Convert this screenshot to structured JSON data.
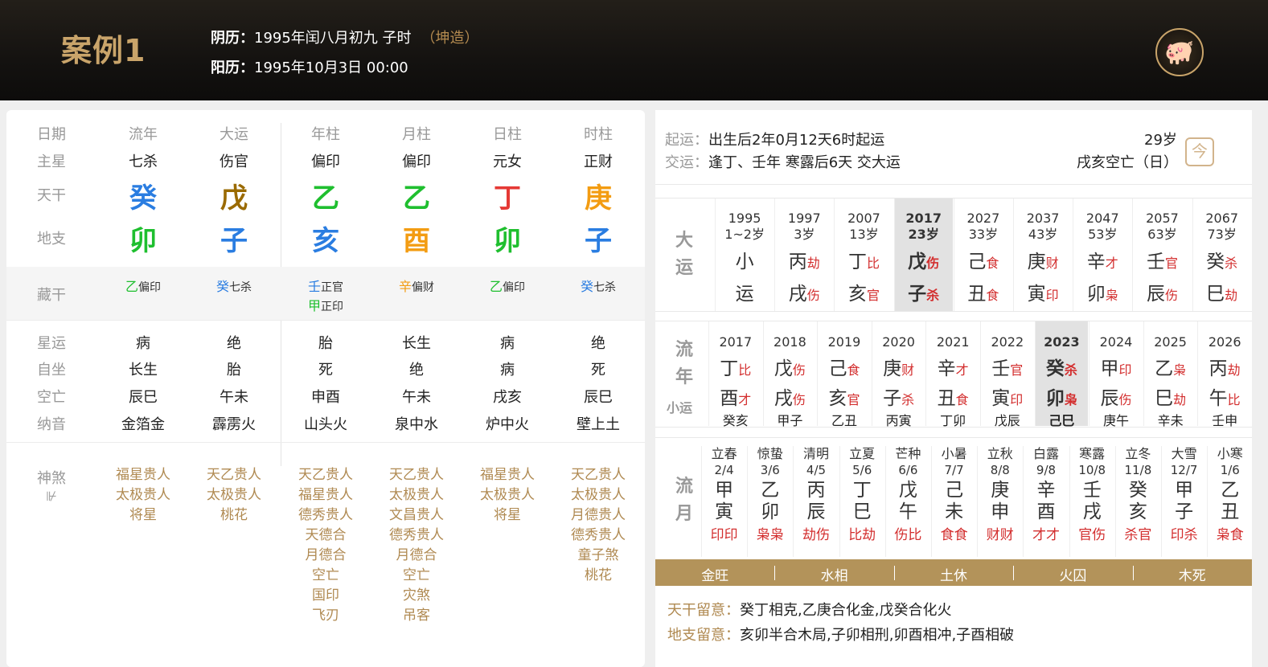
{
  "header": {
    "title": "案例1",
    "lunar_label": "阴历：",
    "lunar": "1995年闰八月初九 子时",
    "gender": "（坤造）",
    "solar_label": "阳历：",
    "solar": "1995年10月3日 00:00",
    "logo": "pig-logo"
  },
  "chart": {
    "headers": [
      "日期",
      "流年",
      "大运",
      "年柱",
      "月柱",
      "日柱",
      "时柱"
    ],
    "row_labels": {
      "zhuxing": "主星",
      "tiangan": "天干",
      "dizhi": "地支",
      "canggan": "藏干",
      "xingyun": "星运",
      "zizuo": "自坐",
      "kongwang": "空亡",
      "nayin": "纳音",
      "shensha": "神煞",
      "shensha_icon": "⊮"
    },
    "zhuxing": [
      "七杀",
      "伤官",
      "偏印",
      "偏印",
      "元女",
      "正财"
    ],
    "tiangan": [
      {
        "c": "癸",
        "color": "#2a7de1"
      },
      {
        "c": "戊",
        "color": "#9a6a00"
      },
      {
        "c": "乙",
        "color": "#1fbf2f"
      },
      {
        "c": "乙",
        "color": "#1fbf2f"
      },
      {
        "c": "丁",
        "color": "#e53935"
      },
      {
        "c": "庚",
        "color": "#f39c12"
      }
    ],
    "dizhi": [
      {
        "c": "卯",
        "color": "#1fbf2f"
      },
      {
        "c": "子",
        "color": "#2a7de1"
      },
      {
        "c": "亥",
        "color": "#2a7de1"
      },
      {
        "c": "酉",
        "color": "#f39c12"
      },
      {
        "c": "卯",
        "color": "#1fbf2f"
      },
      {
        "c": "子",
        "color": "#2a7de1"
      }
    ],
    "canggan": [
      [
        {
          "g": "乙",
          "color": "#1fbf2f",
          "s": "偏印"
        }
      ],
      [
        {
          "g": "癸",
          "color": "#2a7de1",
          "s": "七杀"
        }
      ],
      [
        {
          "g": "壬",
          "color": "#2a7de1",
          "s": "正官"
        },
        {
          "g": "甲",
          "color": "#1fbf2f",
          "s": "正印"
        }
      ],
      [
        {
          "g": "辛",
          "color": "#f39c12",
          "s": "偏财"
        }
      ],
      [
        {
          "g": "乙",
          "color": "#1fbf2f",
          "s": "偏印"
        }
      ],
      [
        {
          "g": "癸",
          "color": "#2a7de1",
          "s": "七杀"
        }
      ]
    ],
    "xingyun": [
      "病",
      "绝",
      "胎",
      "长生",
      "病",
      "绝"
    ],
    "zizuo": [
      "长生",
      "胎",
      "死",
      "绝",
      "病",
      "死"
    ],
    "kongwang": [
      "辰巳",
      "午未",
      "申酉",
      "午未",
      "戌亥",
      "辰巳"
    ],
    "nayin": [
      "金箔金",
      "霹雳火",
      "山头火",
      "泉中水",
      "炉中火",
      "壁上土"
    ],
    "shensha": [
      [
        "福星贵人",
        "太极贵人",
        "将星"
      ],
      [
        "天乙贵人",
        "太极贵人",
        "桃花"
      ],
      [
        "天乙贵人",
        "福星贵人",
        "德秀贵人",
        "天德合",
        "月德合",
        "空亡",
        "国印",
        "飞刃"
      ],
      [
        "天乙贵人",
        "太极贵人",
        "文昌贵人",
        "德秀贵人",
        "月德合",
        "空亡",
        "灾煞",
        "吊客"
      ],
      [
        "福星贵人",
        "太极贵人",
        "将星"
      ],
      [
        "天乙贵人",
        "太极贵人",
        "月德贵人",
        "德秀贵人",
        "童子煞",
        "桃花"
      ]
    ]
  },
  "right": {
    "qiyun_label": "起运：",
    "qiyun": "出生后2年0月12天6时起运",
    "jiaoyun_label": "交运：",
    "jiaoyun": "逢丁、壬年 寒露后6天 交大运",
    "age": "29岁",
    "kongwang": "戌亥空亡（日）",
    "cal_icon": "今",
    "dayun_label": "大运",
    "dayun": [
      {
        "y": "1995",
        "a": "1~2岁",
        "g": "小",
        "gs": "",
        "z": "运",
        "zs": ""
      },
      {
        "y": "1997",
        "a": "3岁",
        "g": "丙",
        "gs": "劫",
        "z": "戌",
        "zs": "伤"
      },
      {
        "y": "2007",
        "a": "13岁",
        "g": "丁",
        "gs": "比",
        "z": "亥",
        "zs": "官"
      },
      {
        "y": "2017",
        "a": "23岁",
        "g": "戊",
        "gs": "伤",
        "z": "子",
        "zs": "杀",
        "active": true
      },
      {
        "y": "2027",
        "a": "33岁",
        "g": "己",
        "gs": "食",
        "z": "丑",
        "zs": "食"
      },
      {
        "y": "2037",
        "a": "43岁",
        "g": "庚",
        "gs": "财",
        "z": "寅",
        "zs": "印"
      },
      {
        "y": "2047",
        "a": "53岁",
        "g": "辛",
        "gs": "才",
        "z": "卯",
        "zs": "枭"
      },
      {
        "y": "2057",
        "a": "63岁",
        "g": "壬",
        "gs": "官",
        "z": "辰",
        "zs": "伤"
      },
      {
        "y": "2067",
        "a": "73岁",
        "g": "癸",
        "gs": "杀",
        "z": "巳",
        "zs": "劫"
      }
    ],
    "liunian_label": "流年",
    "xiaoyun_label": "小运",
    "liunian": [
      {
        "y": "2017",
        "g": "丁",
        "gs": "比",
        "z": "酉",
        "zs": "才",
        "x": "癸亥"
      },
      {
        "y": "2018",
        "g": "戊",
        "gs": "伤",
        "z": "戌",
        "zs": "伤",
        "x": "甲子"
      },
      {
        "y": "2019",
        "g": "己",
        "gs": "食",
        "z": "亥",
        "zs": "官",
        "x": "乙丑"
      },
      {
        "y": "2020",
        "g": "庚",
        "gs": "财",
        "z": "子",
        "zs": "杀",
        "x": "丙寅"
      },
      {
        "y": "2021",
        "g": "辛",
        "gs": "才",
        "z": "丑",
        "zs": "食",
        "x": "丁卯"
      },
      {
        "y": "2022",
        "g": "壬",
        "gs": "官",
        "z": "寅",
        "zs": "印",
        "x": "戊辰"
      },
      {
        "y": "2023",
        "g": "癸",
        "gs": "杀",
        "z": "卯",
        "zs": "枭",
        "x": "己巳",
        "active": true
      },
      {
        "y": "2024",
        "g": "甲",
        "gs": "印",
        "z": "辰",
        "zs": "伤",
        "x": "庚午"
      },
      {
        "y": "2025",
        "g": "乙",
        "gs": "枭",
        "z": "巳",
        "zs": "劫",
        "x": "辛未"
      },
      {
        "y": "2026",
        "g": "丙",
        "gs": "劫",
        "z": "午",
        "zs": "比",
        "x": "壬申"
      }
    ],
    "liuyue_label": "流月",
    "liuyue": [
      {
        "j": "立春",
        "d": "2/4",
        "g": "甲",
        "z": "寅",
        "s": "印印"
      },
      {
        "j": "惊蛰",
        "d": "3/6",
        "g": "乙",
        "z": "卯",
        "s": "枭枭"
      },
      {
        "j": "清明",
        "d": "4/5",
        "g": "丙",
        "z": "辰",
        "s": "劫伤"
      },
      {
        "j": "立夏",
        "d": "5/6",
        "g": "丁",
        "z": "巳",
        "s": "比劫"
      },
      {
        "j": "芒种",
        "d": "6/6",
        "g": "戊",
        "z": "午",
        "s": "伤比"
      },
      {
        "j": "小暑",
        "d": "7/7",
        "g": "己",
        "z": "未",
        "s": "食食"
      },
      {
        "j": "立秋",
        "d": "8/8",
        "g": "庚",
        "z": "申",
        "s": "财财"
      },
      {
        "j": "白露",
        "d": "9/8",
        "g": "辛",
        "z": "酉",
        "s": "才才"
      },
      {
        "j": "寒露",
        "d": "10/8",
        "g": "壬",
        "z": "戌",
        "s": "官伤"
      },
      {
        "j": "立冬",
        "d": "11/8",
        "g": "癸",
        "z": "亥",
        "s": "杀官"
      },
      {
        "j": "大雪",
        "d": "12/7",
        "g": "甲",
        "z": "子",
        "s": "印杀"
      },
      {
        "j": "小寒",
        "d": "1/6",
        "g": "乙",
        "z": "丑",
        "s": "枭食"
      }
    ],
    "wuxing": [
      "金旺",
      "水相",
      "土休",
      "火囚",
      "木死"
    ],
    "tiangan_note_label": "天干留意：",
    "tiangan_note": "癸丁相克,乙庚合化金,戊癸合化火",
    "dizhi_note_label": "地支留意：",
    "dizhi_note": "亥卯半合木局,子卯相刑,卯酉相冲,子酉相破"
  }
}
